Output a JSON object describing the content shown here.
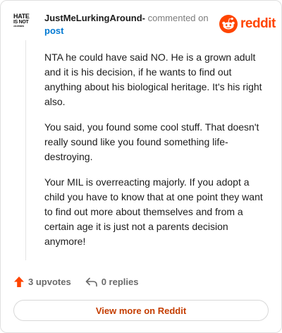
{
  "header": {
    "avatar_lines": [
      "HATE",
      "IS NOT",
      "AN OPINION"
    ],
    "author": "JustMeLurkingAround-",
    "meta_text": " commented on",
    "post_link": "post"
  },
  "brand": {
    "wordmark": "reddit",
    "accent_color": "#ff4500",
    "icon": "reddit-snoo-icon"
  },
  "comment": {
    "paragraphs": [
      "NTA he could have said NO. He is a grown adult and it is his decision, if he wants to find out anything about his biological heritage. It's his right also.",
      "You said, you found some cool stuff. That doesn't really sound like you found something life-destroying.",
      "Your MIL is overreacting majorly. If you adopt a child you have to know that at one point they want to find out more about themselves and from a certain age it is just not a parents decision anymore!"
    ]
  },
  "actions": {
    "upvotes_label": "3 upvotes",
    "upvote_icon": "upvote-arrow-icon",
    "upvote_color": "#ff4500",
    "replies_label": "0 replies",
    "reply_icon": "reply-arrow-icon"
  },
  "footer": {
    "view_more_label": "View more on Reddit"
  }
}
